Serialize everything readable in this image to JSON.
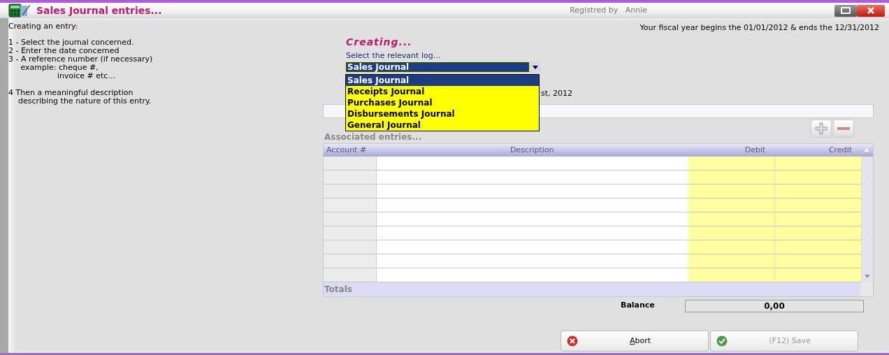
{
  "window": {
    "title": "Sales Journal entries...",
    "registered_label": "Registred by",
    "registered_user": "Annie"
  },
  "instructions": {
    "heading": "Creating an entry:",
    "steps": [
      {
        "text": "1 - Select the journal concerned."
      },
      {
        "text": "2 - Enter the date concerned"
      },
      {
        "text": "3 - A reference number (if necessary)\n     example: cheque #,\n                    invoice # etc..."
      },
      {
        "text": "4 Then a meaningful description\n    describing the nature of this entry."
      }
    ]
  },
  "fiscal_year": "Your fiscal year begins the 01/01/2012 & ends the 12/31/2012",
  "form": {
    "status": "Creating...",
    "journal_label": "Select the relevant log...",
    "journal_value": "Sales Journal",
    "dropdown": {
      "open": true,
      "options": [
        {
          "label": "Sales Journal",
          "selected": true
        },
        {
          "label": "Receipts Journal",
          "selected": false
        },
        {
          "label": "Purchases Journal",
          "selected": false
        },
        {
          "label": "Disbursements Journal",
          "selected": false
        },
        {
          "label": "General Journal",
          "selected": false
        }
      ]
    },
    "date_text": "st, 2012"
  },
  "entries": {
    "title": "Associated entries...",
    "columns": [
      {
        "label": "Account #",
        "kind": "account"
      },
      {
        "label": "Description",
        "kind": "description"
      },
      {
        "label": "Debit",
        "kind": "amount"
      },
      {
        "label": "Credit",
        "kind": "amount"
      }
    ],
    "totals_label": "Totals"
  },
  "balance": {
    "label": "Balance",
    "value": "0,00"
  },
  "buttons": [
    {
      "label": "Abort",
      "kind": "abort",
      "disabled": false
    },
    {
      "label": "(F12) Save",
      "kind": "save",
      "disabled": true
    }
  ]
}
